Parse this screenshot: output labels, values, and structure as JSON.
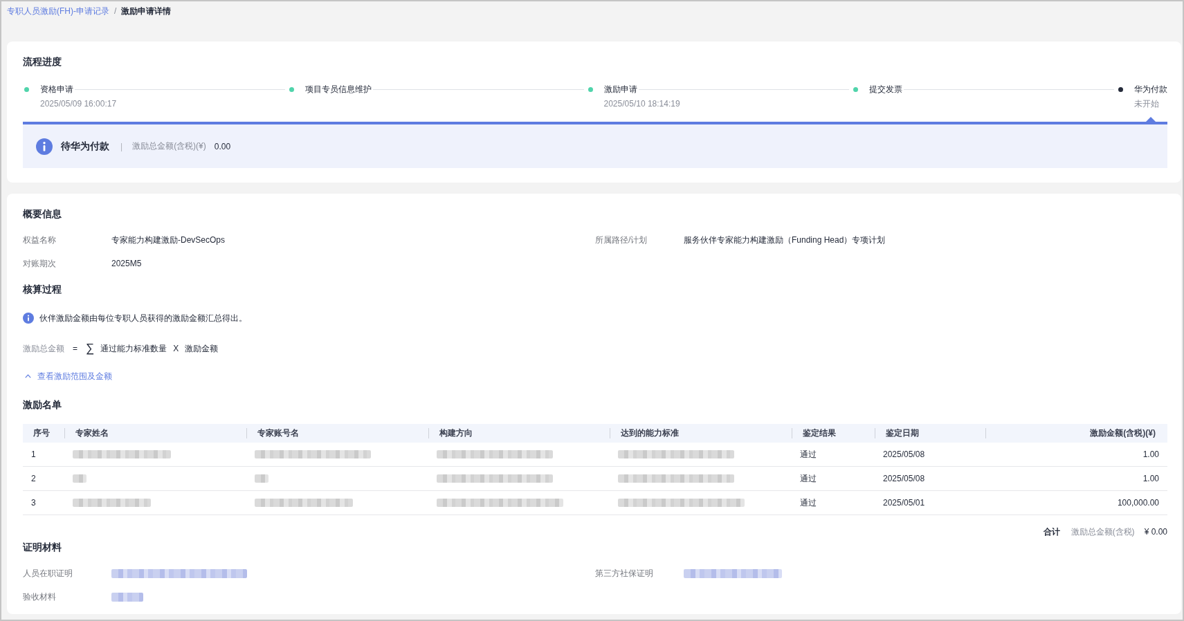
{
  "breadcrumb": {
    "link": "专职人员激励(FH)-申请记录",
    "separator": "/",
    "current": "激励申请详情"
  },
  "process": {
    "title": "流程进度",
    "steps": [
      {
        "label": "资格申请",
        "detail": "2025/05/09 16:00:17",
        "completed": true,
        "selected": false
      },
      {
        "label": "项目专员信息维护",
        "completed": true,
        "selected": false
      },
      {
        "label": "激励申请",
        "detail": "2025/05/10 18:14:19",
        "completed": true,
        "selected": false
      },
      {
        "label": "提交发票",
        "completed": true,
        "selected": false
      },
      {
        "label": "华为付款",
        "detail": "未开始",
        "completed": false,
        "selected": true
      }
    ],
    "status": {
      "title": "待华为付款",
      "divider": "|",
      "amount_label": "激励总金额(含税)(¥)",
      "amount": "0.00"
    }
  },
  "summary": {
    "title": "概要信息",
    "fields": [
      {
        "label": "权益名称",
        "value": "专家能力构建激励-DevSecOps"
      },
      {
        "label": "所属路径/计划",
        "value": "服务伙伴专家能力构建激励（Funding Head）专项计划"
      },
      {
        "label": "对账期次",
        "value": "2025M5"
      }
    ]
  },
  "calculation": {
    "title": "核算过程",
    "note": "伙伴激励金额由每位专职人员获得的激励金额汇总得出。",
    "formula": {
      "lhs": "激励总金额",
      "equals": "=",
      "sum": "∑",
      "term1": "通过能力标准数量",
      "times": "X",
      "term2": "激励金额"
    },
    "toggle": {
      "label": "查看激励范围及金额",
      "expanded": true
    }
  },
  "incentive_list": {
    "title": "激励名单",
    "columns": [
      "序号",
      "专家姓名",
      "专家账号名",
      "构建方向",
      "达到的能力标准",
      "鉴定结果",
      "鉴定日期",
      "激励金额(含税)(¥)"
    ],
    "rows": [
      {
        "cells": [
          {
            "kind": "text",
            "text": "1"
          },
          {
            "kind": "redacted-long"
          },
          {
            "kind": "redacted-xlong"
          },
          {
            "kind": "redacted-xlong"
          },
          {
            "kind": "redacted-xlong"
          },
          {
            "kind": "text",
            "text": "通过"
          },
          {
            "kind": "text",
            "text": "2025/05/08"
          },
          {
            "kind": "text",
            "text": "1.00"
          }
        ]
      },
      {
        "cells": [
          {
            "kind": "text",
            "text": "2"
          },
          {
            "kind": "redacted-tiny"
          },
          {
            "kind": "redacted-tiny"
          },
          {
            "kind": "redacted-xlong"
          },
          {
            "kind": "redacted-xlong"
          },
          {
            "kind": "text",
            "text": "通过"
          },
          {
            "kind": "text",
            "text": "2025/05/08"
          },
          {
            "kind": "text",
            "text": "1.00"
          }
        ]
      },
      {
        "cells": [
          {
            "kind": "text",
            "text": "3"
          },
          {
            "kind": "redacted-medium"
          },
          {
            "kind": "redacted-long"
          },
          {
            "kind": "redacted-xxlong"
          },
          {
            "kind": "redacted-xxlong"
          },
          {
            "kind": "text",
            "text": "通过"
          },
          {
            "kind": "text",
            "text": "2025/05/01"
          },
          {
            "kind": "text",
            "text": "100,000.00"
          }
        ]
      }
    ],
    "total": {
      "label": "合计",
      "amount_label": "激励总金额(含税)",
      "amount": "¥ 0.00"
    }
  },
  "evidence": {
    "title": "证明材料",
    "fields": [
      {
        "label": "人员在职证明",
        "kind": "redacted-xxxlong"
      },
      {
        "label": "第三方社保证明",
        "kind": "redacted-long"
      },
      {
        "label": "验收材料",
        "kind": "redacted-short"
      }
    ]
  }
}
